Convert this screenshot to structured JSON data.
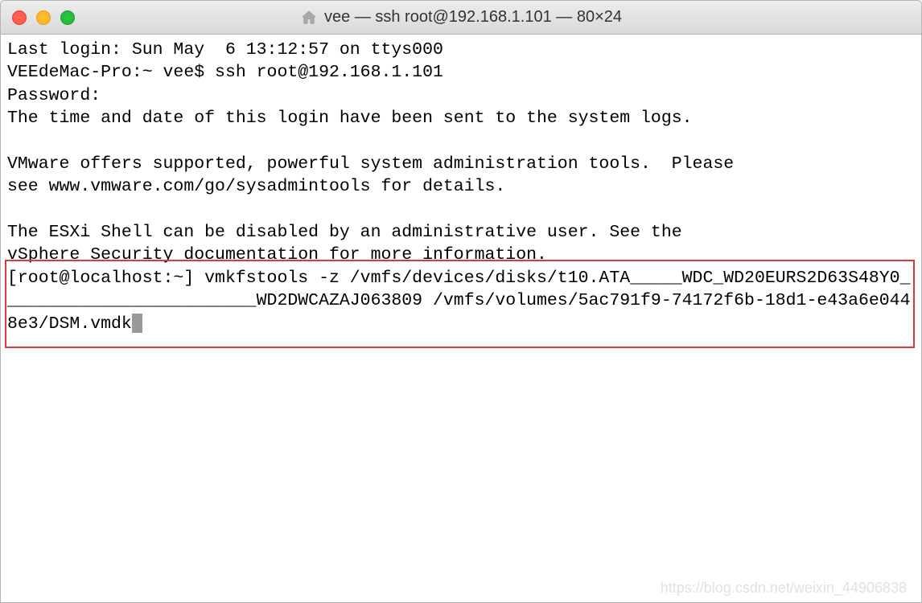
{
  "titlebar": {
    "title": "vee — ssh root@192.168.1.101 — 80×24"
  },
  "terminal": {
    "line1": "Last login: Sun May  6 13:12:57 on ttys000",
    "line2": "VEEdeMac-Pro:~ vee$ ssh root@192.168.1.101",
    "line3": "Password:",
    "line4": "The time and date of this login have been sent to the system logs.",
    "line5": "",
    "line6": "VMware offers supported, powerful system administration tools.  Please",
    "line7": "see www.vmware.com/go/sysadmintools for details.",
    "line8": "",
    "line9": "The ESXi Shell can be disabled by an administrative user. See the",
    "line10": "vSphere Security documentation for more information.",
    "line11": "[root@localhost:~] vmkfstools -z /vmfs/devices/disks/t10.ATA_____WDC_WD20EURS2D63S48Y0_________________________WD2DWCAZAJ063809 /vmfs/volumes/5ac791f9-74172f6b-18d1-e43a6e0448e3/DSM.vmdk"
  },
  "watermark": "https://blog.csdn.net/weixin_44906838"
}
